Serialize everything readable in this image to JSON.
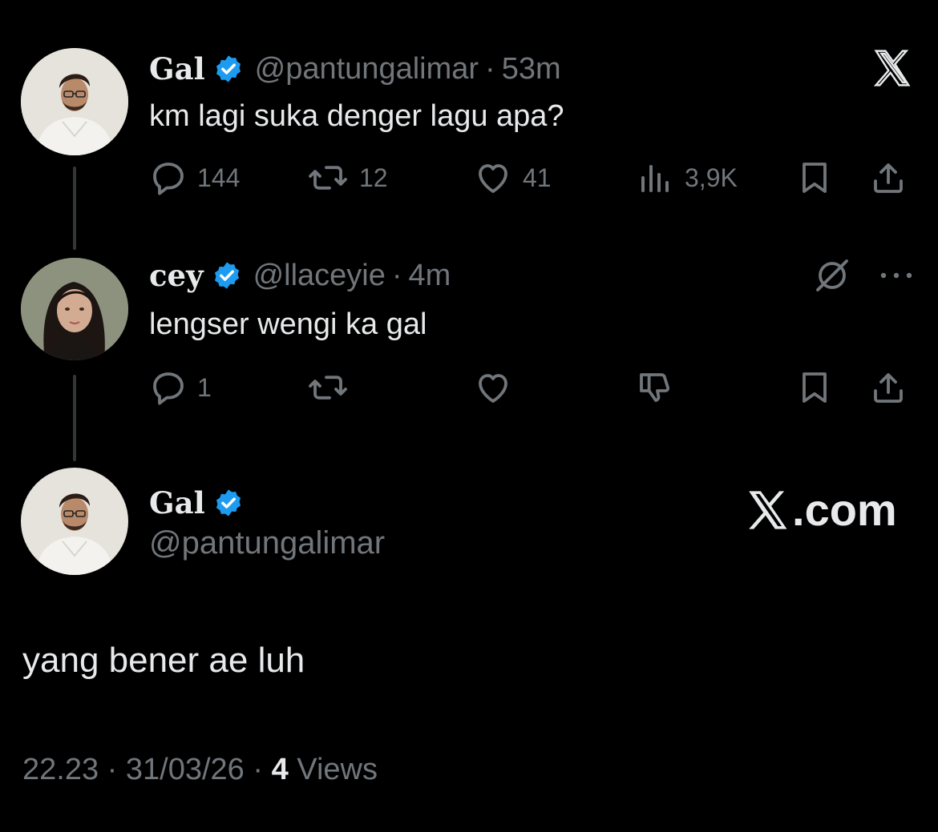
{
  "colors": {
    "background": "#000000",
    "text": "#e7e9ea",
    "muted": "#71767b",
    "verified": "#1d9bf0",
    "thread_line": "#333639"
  },
  "brand": {
    "top_logo_icon": "x-logo-icon",
    "watermark_domain": "com",
    "watermark_icon": "x-logo-icon"
  },
  "tweets": [
    {
      "display_name": "Gal",
      "verified": true,
      "handle": "@pantungalimar",
      "separator": "·",
      "time": "53m",
      "text": "km lagi suka denger lagu apa?",
      "actions": {
        "replies": "144",
        "reposts": "12",
        "likes": "41",
        "views": "3,9K"
      }
    },
    {
      "display_name": "cey",
      "verified": true,
      "handle": "@llaceyie",
      "separator": "·",
      "time": "4m",
      "text": "lengser wengi ka gal",
      "actions": {
        "replies": "1"
      }
    }
  ],
  "main_tweet": {
    "display_name": "Gal",
    "verified": true,
    "handle": "@pantungalimar",
    "text": "yang bener ae luh",
    "time": "22.23",
    "date": "31/03/26",
    "separator": "·",
    "views_count": "4",
    "views_label": "Views"
  }
}
